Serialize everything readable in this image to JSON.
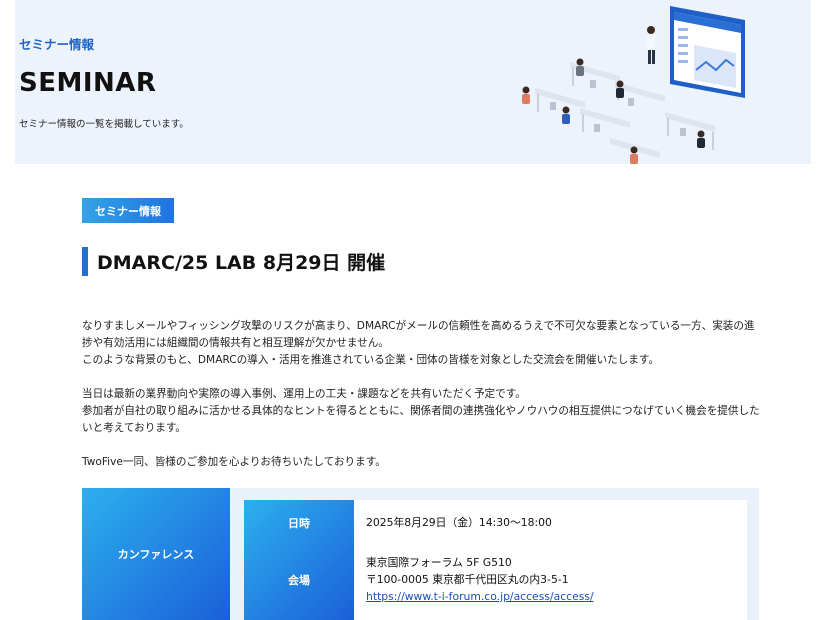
{
  "hero": {
    "subtitle": "セミナー情報",
    "title": "SEMINAR",
    "description": "セミナー情報の一覧を掲載しています。"
  },
  "article": {
    "category_tag": "セミナー情報",
    "title": "DMARC/25 LAB 8月29日 開催",
    "paragraphs": [
      "なりすましメールやフィッシング攻撃のリスクが高まり、DMARCがメールの信頼性を高めるうえで不可欠な要素となっている一方、実装の進捗や有効活用には組織間の情報共有と相互理解が欠かせません。",
      "このような背景のもと、DMARCの導入・活用を推進されている企業・団体の皆様を対象とした交流会を開催いたします。",
      "当日は最新の業界動向や実際の導入事例、運用上の工夫・課題などを共有いただく予定です。",
      "参加者が自社の取り組みに活かせる具体的なヒントを得るとともに、関係者間の連携強化やノウハウの相互提供につなげていく機会を提供したいと考えております。",
      "TwoFive一同、皆様のご参加を心よりお待ちいたしております。"
    ]
  },
  "info_table": {
    "section_label": "カンファレンス",
    "date_label": "日時",
    "date_value": "2025年8月29日（金）14:30～18:00",
    "venue_label": "会場",
    "venue_name": "東京国際フォーラム 5F G510",
    "venue_address": "〒100-0005 東京都千代田区丸の内3-5-1",
    "venue_link": "https://www.t-i-forum.co.jp/access/access/"
  },
  "colors": {
    "accent": "#1f6fd6",
    "hero_bg": "#edf3fc",
    "gradient_start": "#2cb0ee",
    "gradient_end": "#1b5fd8"
  },
  "icons": [
    "seminar-illustration"
  ]
}
